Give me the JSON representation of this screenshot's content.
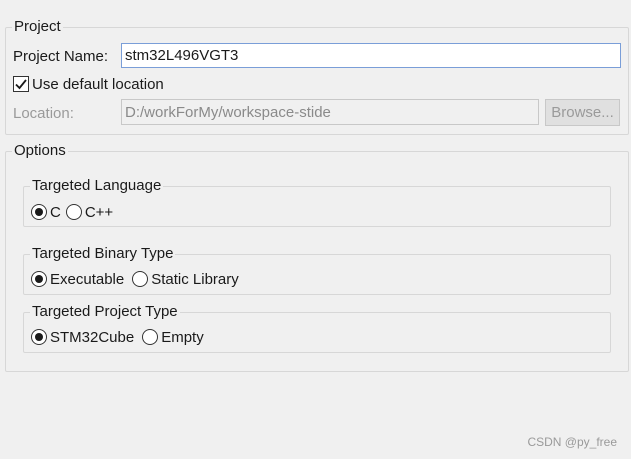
{
  "project": {
    "legend": "Project",
    "name_label": "Project Name:",
    "name_value": "stm32L496VGT3",
    "use_default_label": "Use default location",
    "use_default_checked": true,
    "location_label": "Location:",
    "location_value": "D:/workForMy/workspace-stide",
    "browse_label": "Browse..."
  },
  "options": {
    "legend": "Options",
    "language": {
      "legend": "Targeted Language",
      "choices": [
        {
          "label": "C",
          "selected": true
        },
        {
          "label": "C++",
          "selected": false
        }
      ]
    },
    "binary_type": {
      "legend": "Targeted Binary Type",
      "choices": [
        {
          "label": "Executable",
          "selected": true
        },
        {
          "label": "Static Library",
          "selected": false
        }
      ]
    },
    "project_type": {
      "legend": "Targeted Project Type",
      "choices": [
        {
          "label": "STM32Cube",
          "selected": true
        },
        {
          "label": "Empty",
          "selected": false
        }
      ]
    }
  },
  "watermark": "CSDN @py_free"
}
